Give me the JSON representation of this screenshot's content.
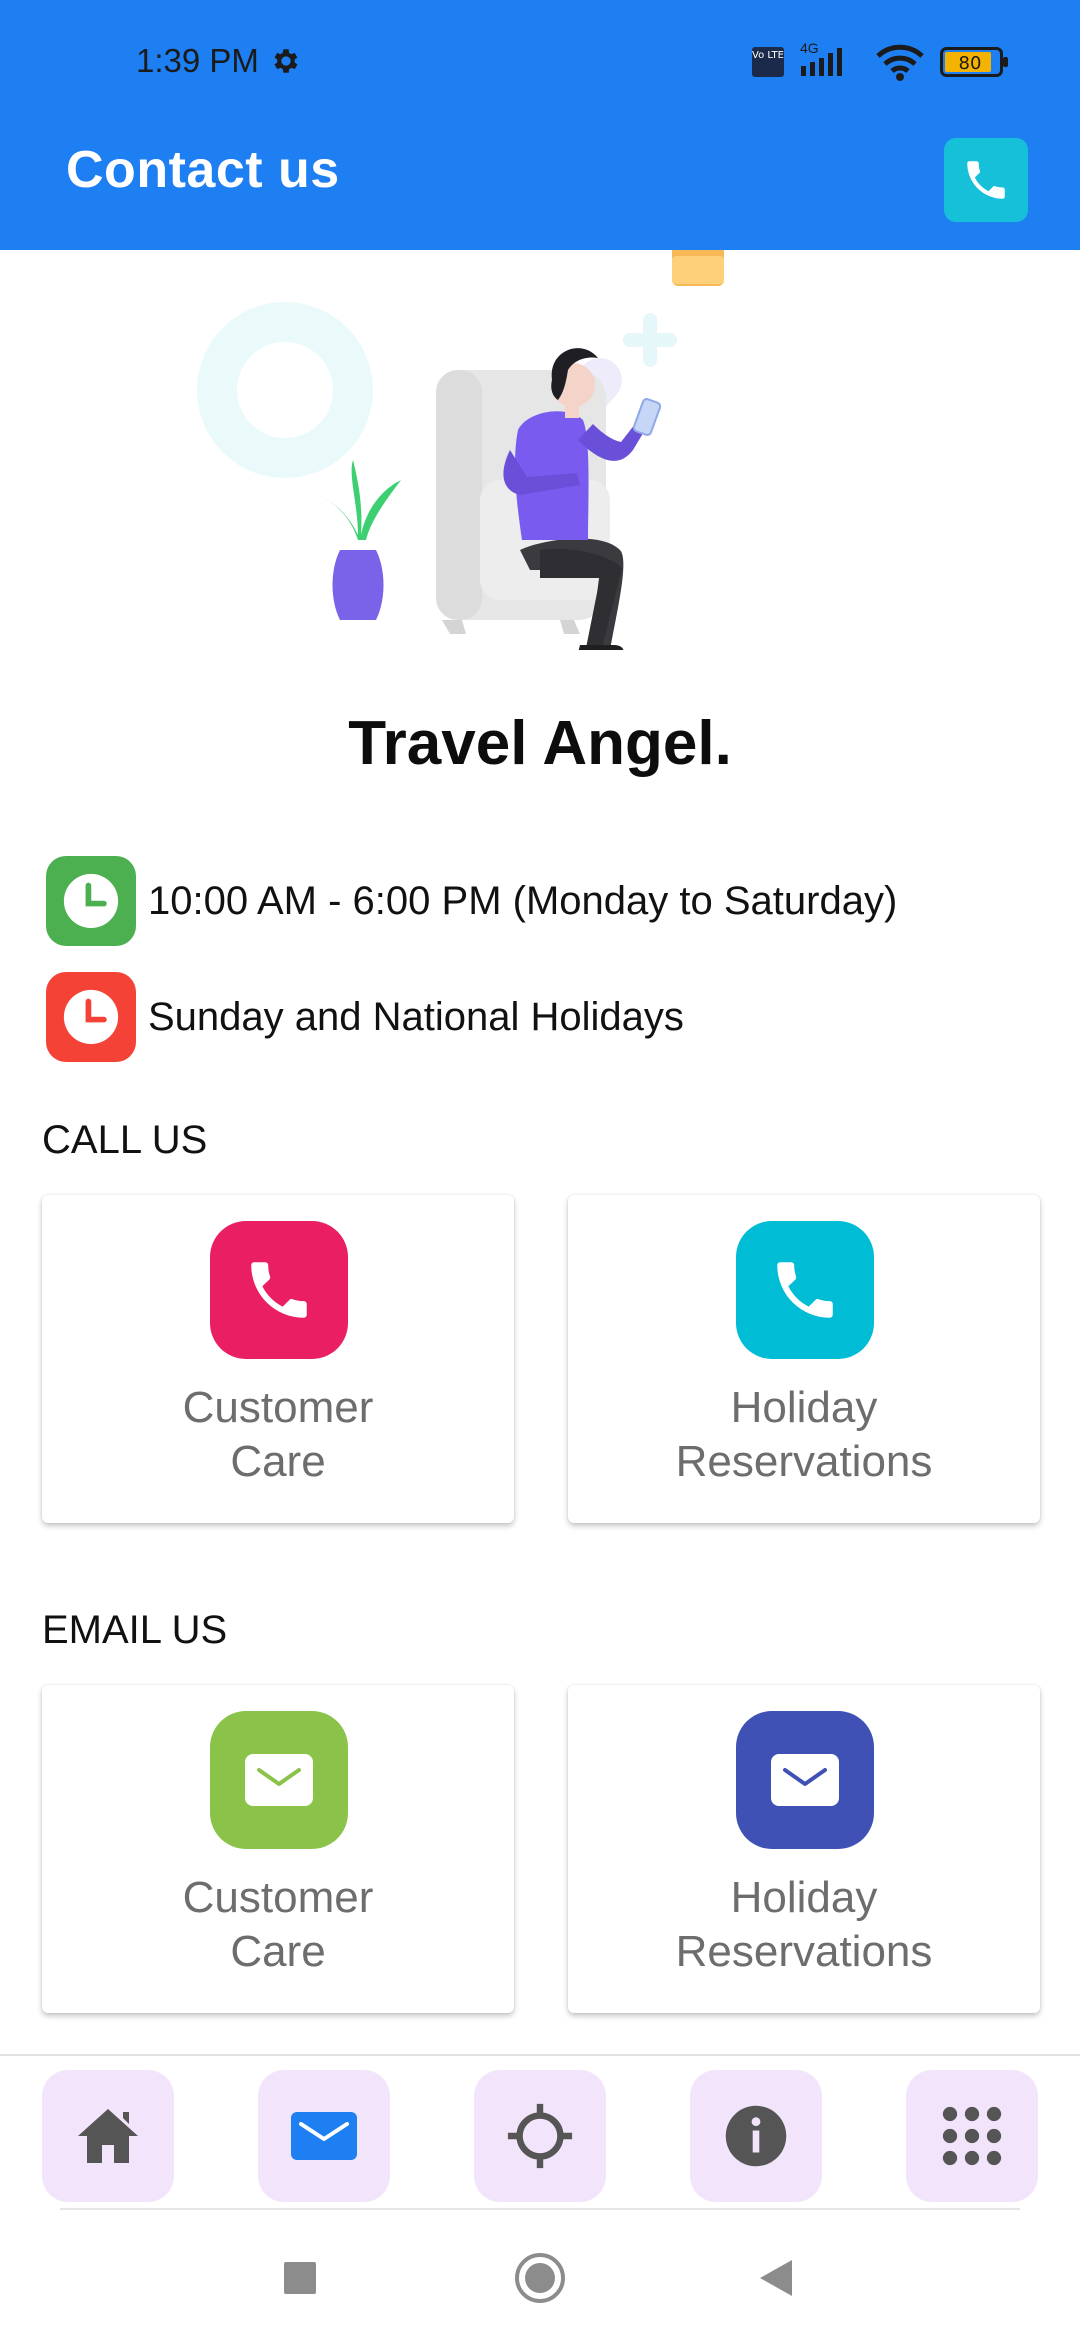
{
  "status_bar": {
    "time": "1:39 PM",
    "volte": "Vo LTE",
    "network": "4G",
    "battery": "80"
  },
  "header": {
    "title": "Contact us"
  },
  "company": {
    "name": "Travel Angel."
  },
  "hours": [
    {
      "text": "10:00 AM - 6:00 PM (Monday to Saturday)",
      "color": "#4caf50",
      "icon": "clock-icon"
    },
    {
      "text": "Sunday and National Holidays",
      "color": "#f44336",
      "icon": "clock-icon"
    }
  ],
  "call_us": {
    "label": "CALL US",
    "cards": [
      {
        "label": "Customer\nCare",
        "color": "#e91e63",
        "icon": "phone-icon"
      },
      {
        "label": "Holiday\nReservations",
        "color": "#00bcd4",
        "icon": "phone-icon"
      }
    ]
  },
  "email_us": {
    "label": "EMAIL US",
    "cards": [
      {
        "label": "Customer\nCare",
        "color": "#8bc34a",
        "icon": "mail-icon"
      },
      {
        "label": "Holiday\nReservations",
        "color": "#3f51b5",
        "icon": "mail-icon"
      }
    ]
  },
  "bottom_nav": [
    {
      "name": "home",
      "icon": "home-icon"
    },
    {
      "name": "email",
      "icon": "mail-icon",
      "active": true
    },
    {
      "name": "locate",
      "icon": "crosshair-icon"
    },
    {
      "name": "info",
      "icon": "info-icon"
    },
    {
      "name": "menu",
      "icon": "grid-icon"
    }
  ],
  "colors": {
    "header": "#1e7ff2",
    "header_call": "#16c0d9",
    "nav_bg": "#f1e4fb",
    "nav_active_icon": "#1e7ff2"
  }
}
